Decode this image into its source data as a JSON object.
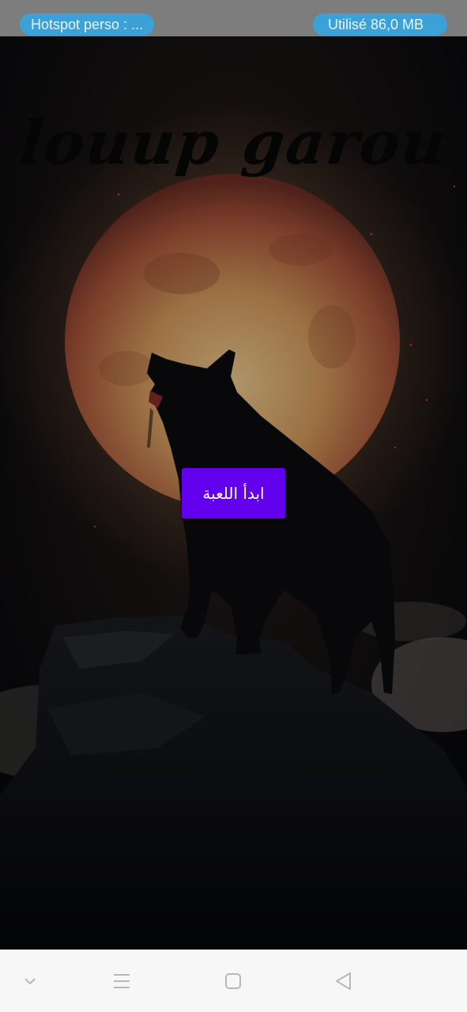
{
  "status_bar": {
    "hotspot_label": "Hotspot perso : ...",
    "data_usage": "Utilisé 86,0 MB"
  },
  "app": {
    "title": "louup  garou",
    "start_button_label": "ابدأ اللعبة",
    "background_image": "howling-wolf-on-rock-with-full-moon"
  },
  "nav_bar": {
    "icons": [
      "chevron-down-icon",
      "menu-icon",
      "home-square-icon",
      "back-triangle-icon"
    ]
  },
  "colors": {
    "status_bar_bg": "#7d7d7d",
    "pill_bg": "#3ba1d6",
    "button_bg": "#6200ee",
    "nav_bar_bg": "#f7f7f7",
    "moon": "#d79a5e"
  }
}
